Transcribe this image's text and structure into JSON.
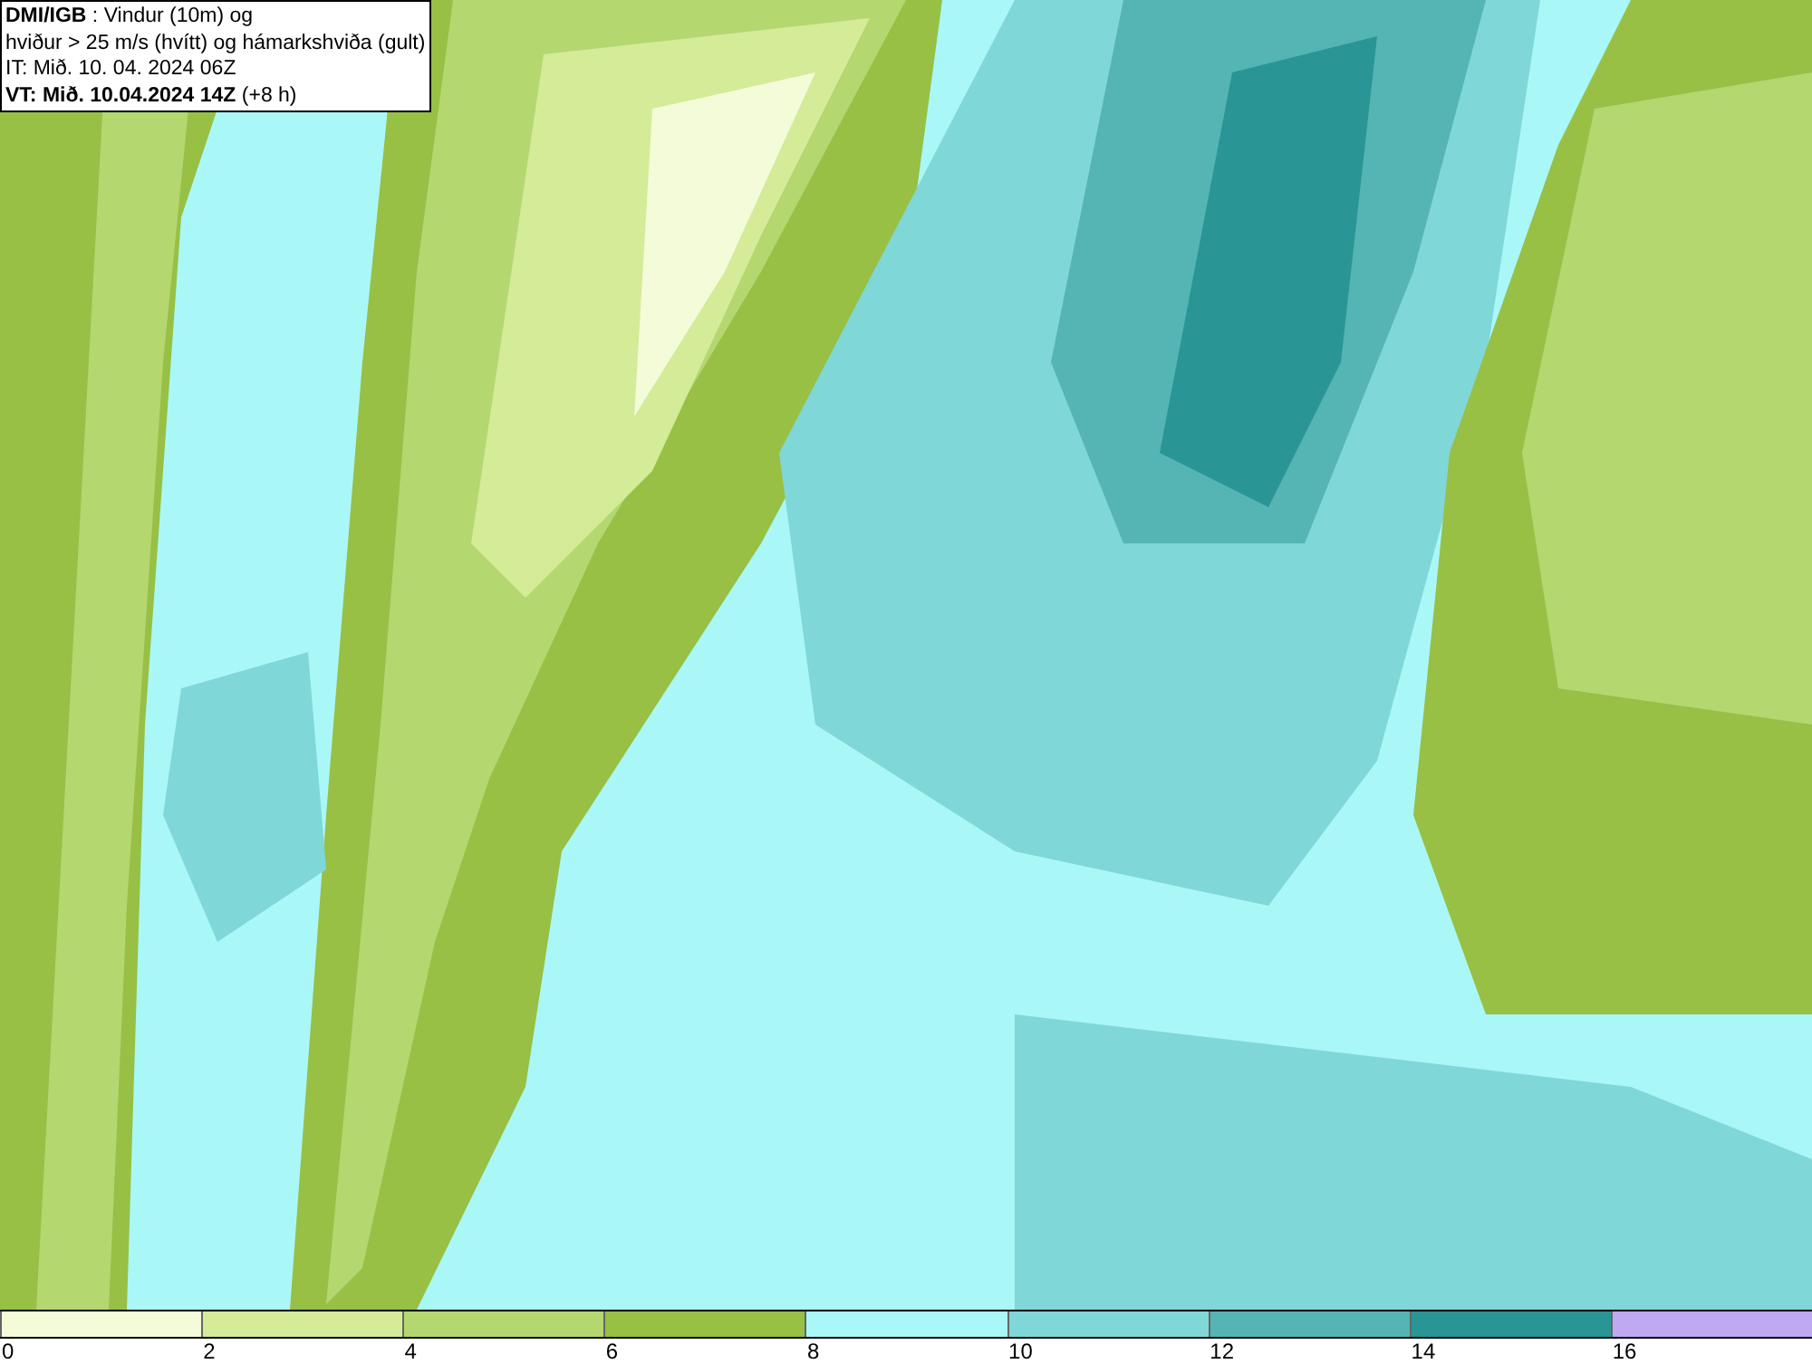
{
  "info_box": {
    "lines": [
      "**DMI/IGB** : Vindur (10m) og",
      "hviður > 25 m/s (hvítt) og hámarkshviða (gult)",
      "IT: Mið. 10. 04. 2024 06Z",
      "**VT: Mið. 10.04.2024 14Z** (+8 h)"
    ]
  },
  "color_scale": {
    "segments": [
      {
        "color": "#f4fbd8"
      },
      {
        "color": "#d4eb98"
      },
      {
        "color": "#b4d770"
      },
      {
        "color": "#97c045"
      },
      {
        "color": "#aaf7f7"
      },
      {
        "color": "#80d7d7"
      },
      {
        "color": "#55b5b5"
      },
      {
        "color": "#2a9595"
      },
      {
        "color": "#bea9f2"
      }
    ],
    "ticks": [
      "0",
      "2",
      "4",
      "6",
      "8",
      "10",
      "12",
      "14",
      "16"
    ]
  }
}
